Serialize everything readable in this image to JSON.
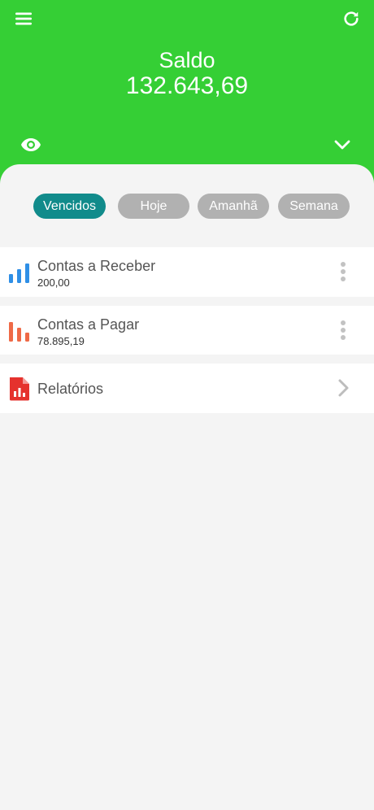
{
  "header": {
    "balance_label": "Saldo",
    "balance_value": "132.643,69",
    "background_color": "#35cf35",
    "icons": {
      "menu": "hamburger-menu-icon",
      "refresh": "refresh-icon",
      "visibility": "eye-icon",
      "expand": "chevron-down-icon"
    }
  },
  "filters": {
    "chips": [
      {
        "label": "Vencidos",
        "active": true
      },
      {
        "label": "Hoje",
        "active": false
      },
      {
        "label": "Amanhã",
        "active": false
      },
      {
        "label": "Semana",
        "active": false
      }
    ],
    "active_color": "#118b8b",
    "inactive_color": "#b1b1b1"
  },
  "cards": [
    {
      "title": "Contas a Receber",
      "value": "200,00",
      "icon": "bar-chart-up-icon",
      "icon_color": "#2f8fe6"
    },
    {
      "title": "Contas a Pagar",
      "value": "78.895,19",
      "icon": "bar-chart-down-icon",
      "icon_color": "#ef6a47"
    },
    {
      "title": "Relatórios",
      "icon": "report-document-icon",
      "icon_color": "#e5322d"
    }
  ]
}
